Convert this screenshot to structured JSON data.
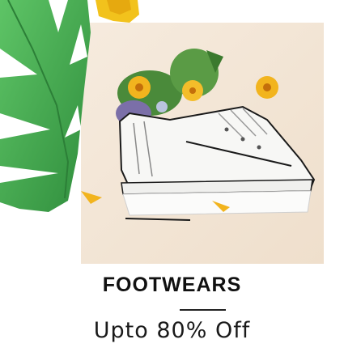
{
  "promo": {
    "title": "FOOTWEARS",
    "offer": "Upto 80% Off"
  },
  "colors": {
    "backdrop": "#f3e6d6",
    "leaf": "#3da34a",
    "shoe": "#f7f7f5",
    "flower": "#f2b41e",
    "text": "#111111"
  },
  "icons": {
    "banner": "sneaker-product-photo"
  }
}
